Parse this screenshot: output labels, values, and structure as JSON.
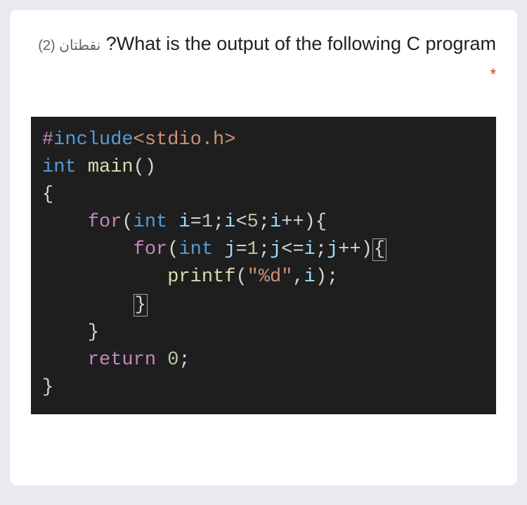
{
  "question": {
    "points_label": "نقطتان (2)",
    "text_part1": "What is the output of the following C program?",
    "required_mark": "*"
  },
  "code": {
    "hash": "#",
    "include_kw": "include",
    "lt": "<",
    "header": "stdio.h",
    "gt": ">",
    "int_kw": "int",
    "main_name": "main",
    "parens": "()",
    "obrace": "{",
    "for_kw": "for",
    "oparen": "(",
    "i_name": "i",
    "eq": "=",
    "one": "1",
    "semi": ";",
    "lt_op": "<",
    "five": "5",
    "inc": "++",
    "cparen": ")",
    "j_name": "j",
    "le_op": "<=",
    "printf_name": "printf",
    "fmt": "\"%d\"",
    "comma": ",",
    "cbrace": "}",
    "return_kw": "return",
    "zero": "0"
  }
}
